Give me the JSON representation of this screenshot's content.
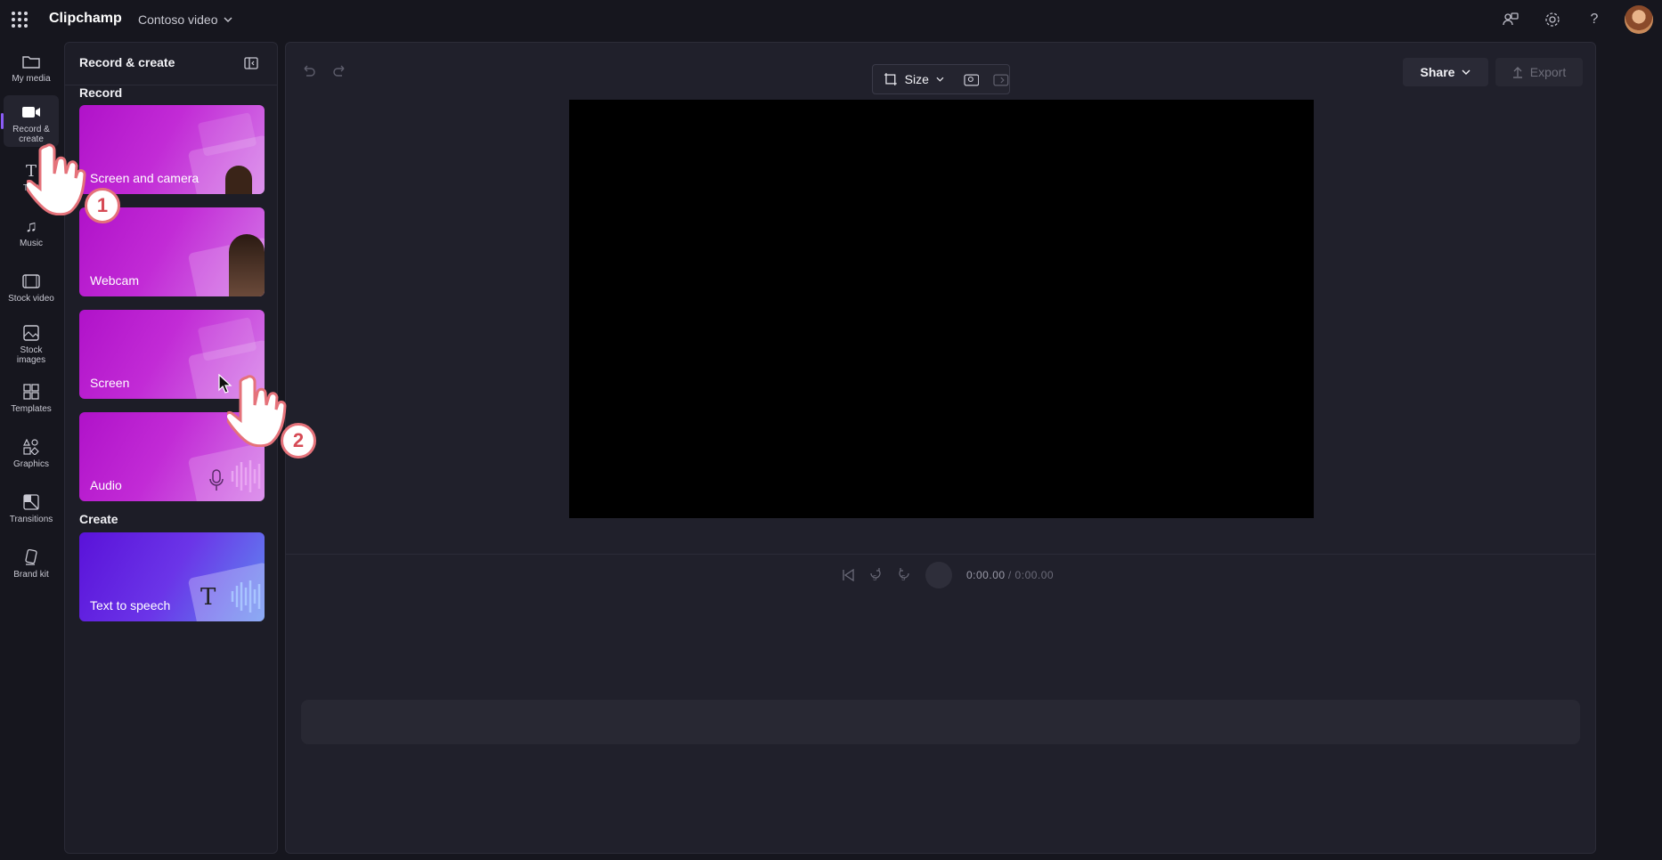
{
  "app": {
    "title": "Clipchamp",
    "project_name": "Contoso video"
  },
  "rail": {
    "items": [
      {
        "label": "My media",
        "icon": "folder-icon"
      },
      {
        "label": "Record & create",
        "icon": "video-camera-icon",
        "active": true
      },
      {
        "label": "Text",
        "icon": "text-icon"
      },
      {
        "label": "Music",
        "icon": "music-note-icon"
      },
      {
        "label": "Stock video",
        "icon": "film-icon"
      },
      {
        "label": "Stock images",
        "icon": "image-icon"
      },
      {
        "label": "Templates",
        "icon": "templates-icon"
      },
      {
        "label": "Graphics",
        "icon": "shapes-icon"
      },
      {
        "label": "Transitions",
        "icon": "transitions-icon"
      },
      {
        "label": "Brand kit",
        "icon": "brand-kit-icon"
      }
    ]
  },
  "panel": {
    "title": "Record & create",
    "record_section": "Record",
    "create_section": "Create",
    "cards": [
      {
        "label": "Screen and camera"
      },
      {
        "label": "Webcam"
      },
      {
        "label": "Screen"
      },
      {
        "label": "Audio"
      },
      {
        "label": "Text to speech"
      }
    ]
  },
  "editor": {
    "size_label": "Size",
    "share_label": "Share",
    "export_label": "Export",
    "time_current": "0:00.00",
    "time_total": "/ 0:00.00",
    "skip_back_seconds": "5",
    "skip_forward_seconds": "5"
  },
  "overlays": {
    "step1": "1",
    "step2": "2"
  },
  "colors": {
    "accent": "#8b5cf6",
    "card_gradient_start": "#b012c9",
    "tts_gradient_start": "#5a12d9"
  }
}
